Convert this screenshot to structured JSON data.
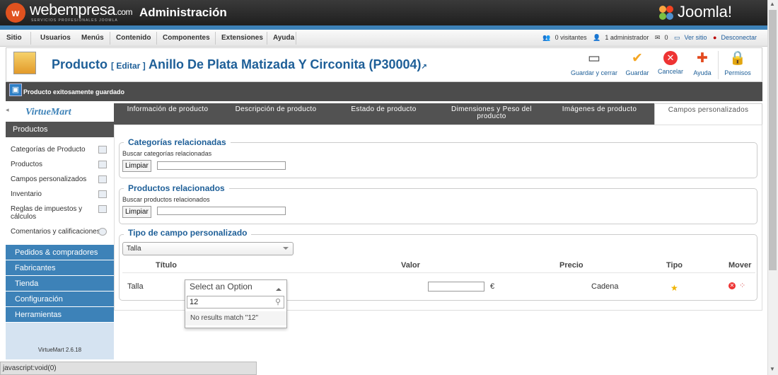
{
  "header": {
    "brand": "webempresa",
    "brand_suffix": ".com",
    "brand_sub": "SERVICIOS PROFESIONALES JOOMLA",
    "title": "Administración",
    "joomla": "Joomla!"
  },
  "menu": [
    "Sitio",
    "Usuarios",
    "Menús",
    "Contenido",
    "Componentes",
    "Extensiones",
    "Ayuda"
  ],
  "status": {
    "visitors": "0 visitantes",
    "admins": "1 administrador",
    "messages": "0",
    "view_site": "Ver sitio",
    "logout": "Desconectar"
  },
  "page": {
    "title_main": "Producto",
    "title_edit": "[ Editar ]",
    "title_rest": "Anillo De Plata Matizada Y Circonita (P30004)"
  },
  "toolbar": {
    "save_close": "Guardar y cerrar",
    "save": "Guardar",
    "cancel": "Cancelar",
    "help": "Ayuda",
    "permissions": "Permisos"
  },
  "message": "Producto exitosamente guardado",
  "sidebar": {
    "logo": "VirtueMart",
    "section": "Productos",
    "items": [
      "Categorías de Producto",
      "Productos",
      "Campos personalizados",
      "Inventario",
      "Reglas de impuestos y cálculos",
      "Comentarios y calificaciones"
    ],
    "categories": [
      "Pedidos & compradores",
      "Fabricantes",
      "Tienda",
      "Configuración",
      "Herramientas"
    ],
    "version": "VirtueMart 2.6.18"
  },
  "tabs": [
    "Información de producto",
    "Descripción de producto",
    "Estado de producto",
    "Dimensiones y Peso del producto",
    "Imágenes de producto",
    "Campos personalizados"
  ],
  "related_categories": {
    "legend": "Categorías relacionadas",
    "label": "Buscar categorías relacionadas",
    "button": "Limpiar",
    "value": ""
  },
  "related_products": {
    "legend": "Productos relacionados",
    "label": "Buscar productos relacionados",
    "button": "Limpiar",
    "value": ""
  },
  "custom_field": {
    "legend": "Tipo de campo personalizado",
    "select_value": "Talla",
    "columns": [
      "Título",
      "Valor",
      "Precio",
      "Tipo",
      "Mover"
    ],
    "row": {
      "title": "Talla",
      "value_placeholder": "Select an Option",
      "price": "",
      "currency": "€",
      "type": "Cadena"
    }
  },
  "dropdown": {
    "search_value": "12",
    "no_results": "No results match \"12\""
  },
  "statusbar": "javascript:void(0)",
  "colors": {
    "accent": "#3d82b8",
    "title": "#1e5f98",
    "dark": "#525252"
  }
}
